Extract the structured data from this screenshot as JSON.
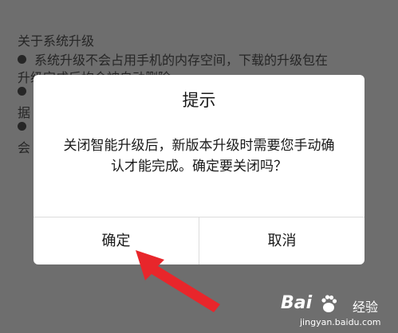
{
  "background": {
    "title": "关于系统升级",
    "lines": [
      "系统升级不会占用手机的内存空间，下载的升级包在",
      "升级完成后均会被自动删除",
      "据",
      "会"
    ]
  },
  "dialog": {
    "title": "提示",
    "message": "关闭智能升级后，新版本升级时需要您手动确认才能完成。确定要关闭吗？",
    "confirm_label": "确定",
    "cancel_label": "取消"
  },
  "watermark": {
    "brand": "Bai",
    "suffix": "经验",
    "url": "jingyan.baidu.com"
  },
  "colors": {
    "overlay_background": "#6e6e6e",
    "dialog_background": "#ffffff",
    "arrow": "#e8262b",
    "text": "#1a1a1a"
  },
  "icons": {
    "arrow": "red-arrow-icon",
    "paw": "baidu-paw-icon"
  }
}
